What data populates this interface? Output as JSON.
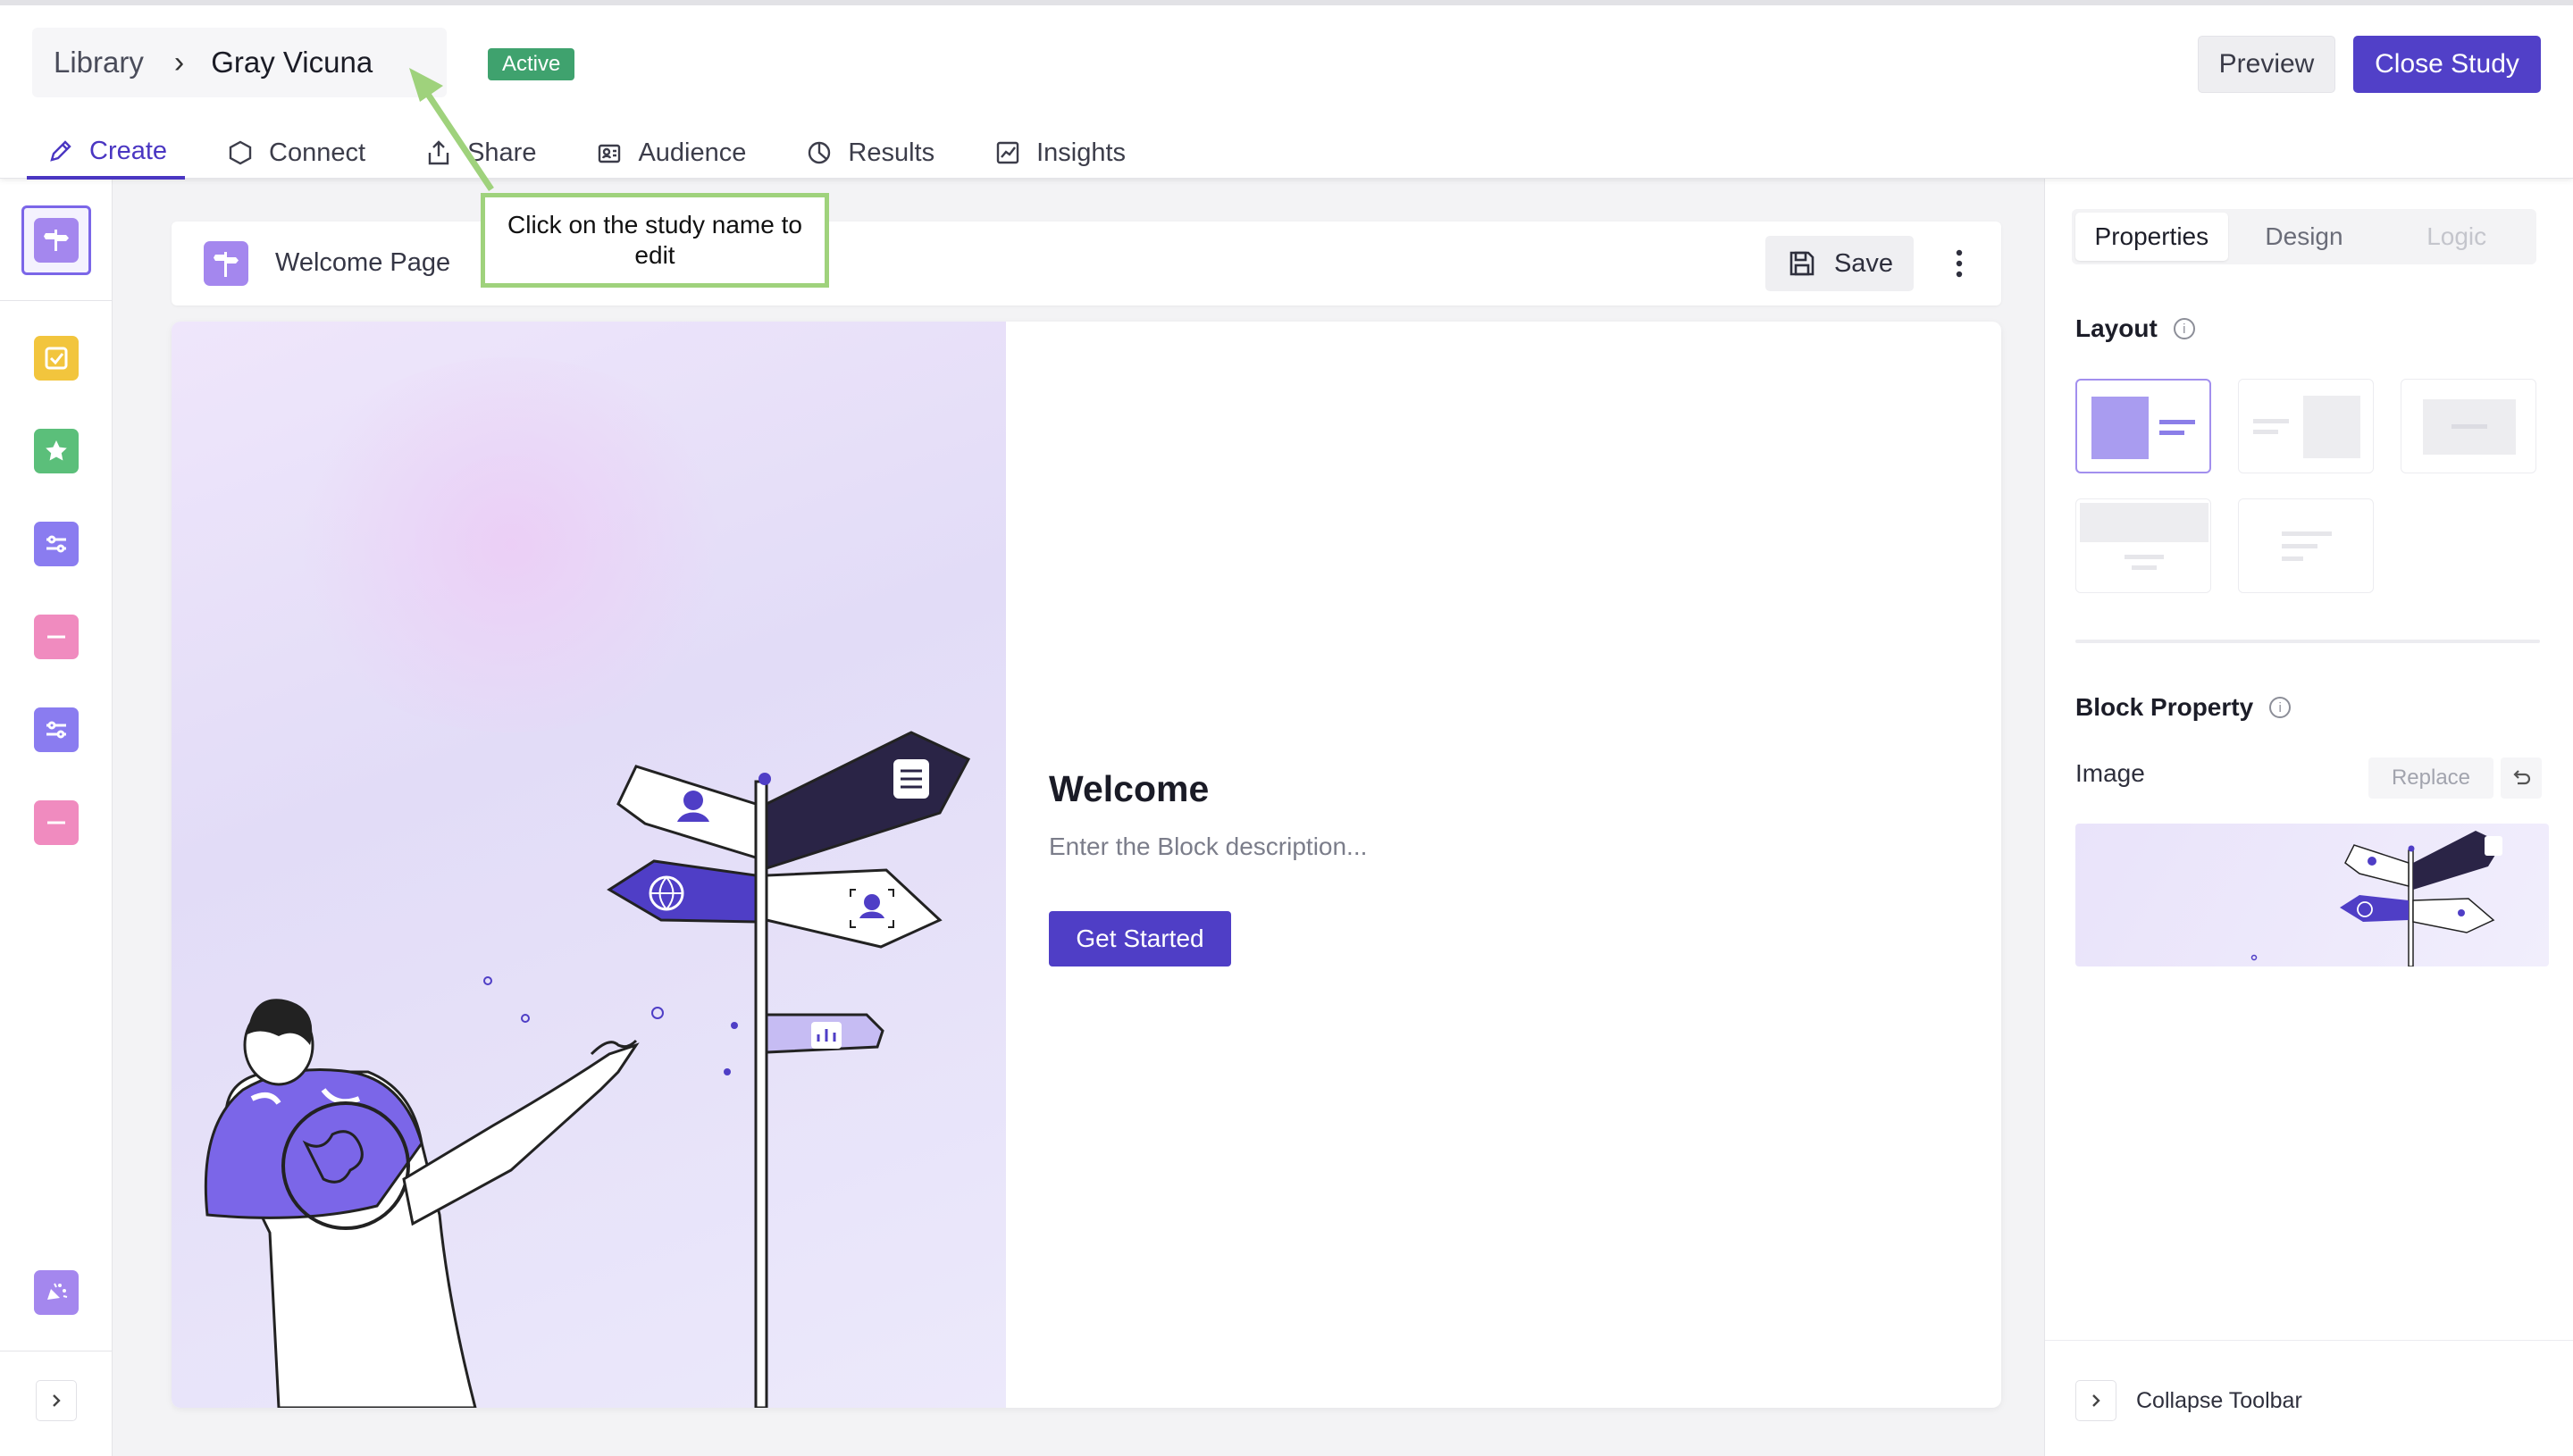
{
  "header": {
    "breadcrumb_root": "Library",
    "breadcrumb_sep": "›",
    "study_name": "Gray Vicuna",
    "status_badge": "Active",
    "preview_label": "Preview",
    "close_label": "Close Study"
  },
  "tabs": [
    {
      "label": "Create",
      "icon": "pencil-icon",
      "active": true
    },
    {
      "label": "Connect",
      "icon": "hexagon-icon"
    },
    {
      "label": "Share",
      "icon": "share-icon"
    },
    {
      "label": "Audience",
      "icon": "audience-icon"
    },
    {
      "label": "Results",
      "icon": "pie-chart-icon"
    },
    {
      "label": "Insights",
      "icon": "line-chart-icon"
    }
  ],
  "leftrail": {
    "items": [
      {
        "icon": "welcome-block-icon",
        "color": "#a487ee",
        "selected": true
      },
      {
        "icon": "checkbox-block-icon",
        "color": "#f2c53d"
      },
      {
        "icon": "star-rating-block-icon",
        "color": "#5bbf7a"
      },
      {
        "icon": "slider-block-icon",
        "color": "#8a7cf0"
      },
      {
        "icon": "text-block-icon",
        "color": "#f08bbf"
      },
      {
        "icon": "slider-block-icon",
        "color": "#8a7cf0"
      },
      {
        "icon": "text-block-icon",
        "color": "#f08bbf"
      },
      {
        "icon": "thank-you-block-icon",
        "color": "#a487ee"
      }
    ]
  },
  "block": {
    "title": "Welcome Page",
    "save_label": "Save"
  },
  "card": {
    "heading": "Welcome",
    "description": "Enter the Block description...",
    "button_label": "Get Started"
  },
  "tooltip": {
    "text": "Click on the study name to edit"
  },
  "rightpanel": {
    "tabs": [
      "Properties",
      "Design",
      "Logic"
    ],
    "layout_title": "Layout",
    "block_property_title": "Block Property",
    "image_label": "Image",
    "replace_label": "Replace",
    "collapse_label": "Collapse Toolbar"
  },
  "colors": {
    "primary": "#4f3ec6",
    "active_badge": "#3fa26e",
    "tooltip_border": "#9fd27c"
  }
}
